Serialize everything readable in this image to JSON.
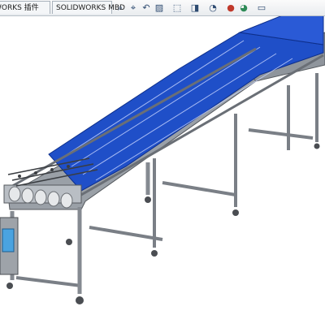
{
  "tabs": [
    {
      "label": "WORKS 插件"
    },
    {
      "label": "SOLIDWORKS MBD"
    }
  ],
  "heads_up_toolbar": {
    "items": [
      {
        "icon": "zoom-to-fit-icon",
        "glyph": "⌕"
      },
      {
        "icon": "zoom-area-icon",
        "glyph": "⌖"
      },
      {
        "icon": "previous-view-icon",
        "glyph": "↶"
      },
      {
        "icon": "section-view-icon",
        "glyph": "▨"
      },
      {
        "icon": "view-orientation-icon",
        "glyph": "⬚"
      },
      {
        "icon": "display-style-icon",
        "glyph": "◨"
      },
      {
        "icon": "hide-show-items-icon",
        "glyph": "◔"
      },
      {
        "icon": "edit-appearance-icon",
        "glyph": "●"
      },
      {
        "icon": "apply-scene-icon",
        "glyph": "◕"
      },
      {
        "icon": "view-settings-icon",
        "glyph": "▭"
      }
    ]
  },
  "colors": {
    "belt": "#1f4fc8",
    "frame": "#8a8f96",
    "background": "#ffffff"
  }
}
